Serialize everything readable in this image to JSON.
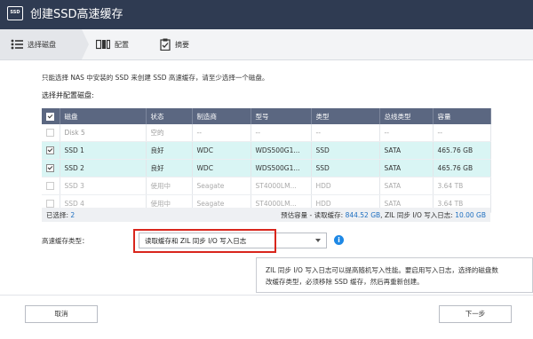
{
  "window": {
    "title": "创建SSD高速缓存",
    "app_icon_text": "SSD"
  },
  "steps": [
    {
      "label": "选择磁盘",
      "icon": "disk-list-icon",
      "active": true
    },
    {
      "label": "配置",
      "icon": "configure-icon",
      "active": false
    },
    {
      "label": "摘要",
      "icon": "summary-clipboard-icon",
      "active": false
    }
  ],
  "instruction": "只能选择 NAS 中安装的 SSD 来创建 SSD 高速缓存，请至少选择一个磁盘。",
  "section_label": "选择并配置磁盘:",
  "table": {
    "headers": [
      "",
      "磁盘",
      "状态",
      "制造商",
      "型号",
      "类型",
      "总线类型",
      "容量"
    ],
    "rows": [
      {
        "checked": false,
        "disabled": false,
        "selected": false,
        "disk": "Disk 5",
        "status": "空的",
        "vendor": "--",
        "model": "--",
        "type": "--",
        "bus": "--",
        "capacity": "--"
      },
      {
        "checked": true,
        "disabled": false,
        "selected": true,
        "disk": "SSD 1",
        "status": "良好",
        "vendor": "WDC",
        "model": "WDS500G1...",
        "type": "SSD",
        "bus": "SATA",
        "capacity": "465.76 GB"
      },
      {
        "checked": true,
        "disabled": false,
        "selected": true,
        "disk": "SSD 2",
        "status": "良好",
        "vendor": "WDC",
        "model": "WDS500G1...",
        "type": "SSD",
        "bus": "SATA",
        "capacity": "465.76 GB"
      },
      {
        "checked": false,
        "disabled": true,
        "selected": false,
        "disk": "SSD 3",
        "status": "使用中",
        "vendor": "Seagate",
        "model": "ST4000LM...",
        "type": "HDD",
        "bus": "SATA",
        "capacity": "3.64 TB"
      },
      {
        "checked": false,
        "disabled": true,
        "selected": false,
        "disk": "SSD 4",
        "status": "使用中",
        "vendor": "Seagate",
        "model": "ST4000LM...",
        "type": "HDD",
        "bus": "SATA",
        "capacity": "3.64 TB"
      }
    ]
  },
  "summary": {
    "selected_label": "已选择:",
    "selected_count": "2",
    "estimate_label": "预估容量 - 读取缓存:",
    "read_cache": "844.52 GB",
    "separator": ", ",
    "zil_label": "ZIL 同步 I/O 写入日志:",
    "zil_value": "10.00 GB"
  },
  "cache_mode": {
    "label": "高速缓存类型：",
    "value": "读取缓存和 ZIL 同步 I/O 写入日志",
    "info_icon": "i"
  },
  "note": {
    "line1": "ZIL 同步 I/O 写入日志可以提高随机写入性能。要启用写入日志，选择的磁盘数",
    "line2": "改缓存类型，必须移除 SSD 缓存，然后再重新创建。"
  },
  "buttons": {
    "cancel": "取消",
    "next": "下一步"
  },
  "colors": {
    "titlebar": "#2f3b52",
    "table_header": "#5b6781",
    "selected_row": "#d9f5f4",
    "highlight_box": "#d9261c",
    "info": "#1e88e5"
  }
}
